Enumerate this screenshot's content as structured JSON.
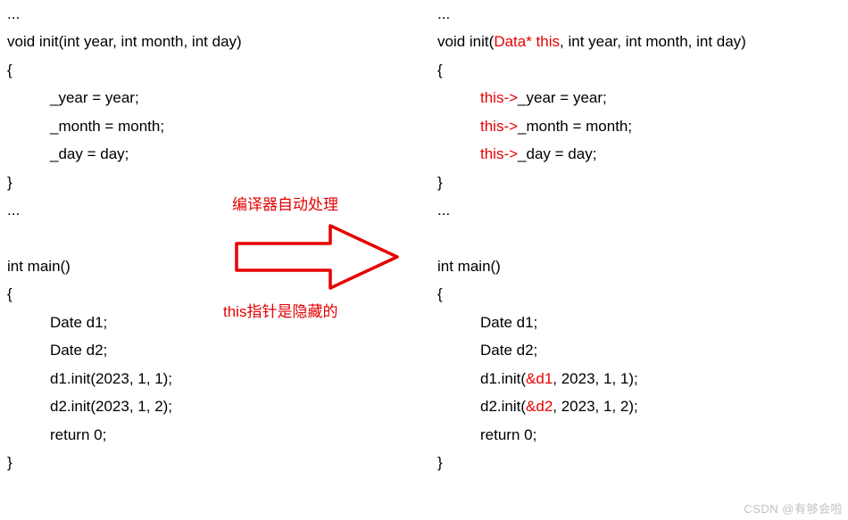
{
  "left": {
    "l0": "...",
    "l1a": "void init(int year, int month, int day)",
    "l2": "{",
    "l3": "_year = year;",
    "l4": "_month = month;",
    "l5": "_day = day;",
    "l6": "}",
    "l7": "...",
    "m0": "int main()",
    "m1": "{",
    "m2": "Date d1;",
    "m3": "Date d2;",
    "m4": "d1.init(2023, 1, 1);",
    "m5": "d2.init(2023, 1, 2);",
    "m6": "return 0;",
    "m7": "}"
  },
  "right": {
    "l0": "...",
    "l1a": "void init(",
    "l1b": "Data* this",
    "l1c": ", int year, int month, int day)",
    "l2": "{",
    "l3a": "this->",
    "l3b": "_year = year;",
    "l4a": "this->",
    "l4b": "_month = month;",
    "l5a": "this->",
    "l5b": "_day = day;",
    "l6": "}",
    "l7": "...",
    "m0": "int main()",
    "m1": "{",
    "m2": "Date d1;",
    "m3": "Date d2;",
    "m4a": "d1.init(",
    "m4b": "&d1",
    "m4c": ", 2023, 1, 1);",
    "m5a": "d2.init(",
    "m5b": "&d2",
    "m5c": ", 2023, 1, 2);",
    "m6": "return 0;",
    "m7": "}"
  },
  "labels": {
    "top": "编译器自动处理",
    "bottom": "this指针是隐藏的"
  },
  "watermark": "CSDN @有够会啦"
}
